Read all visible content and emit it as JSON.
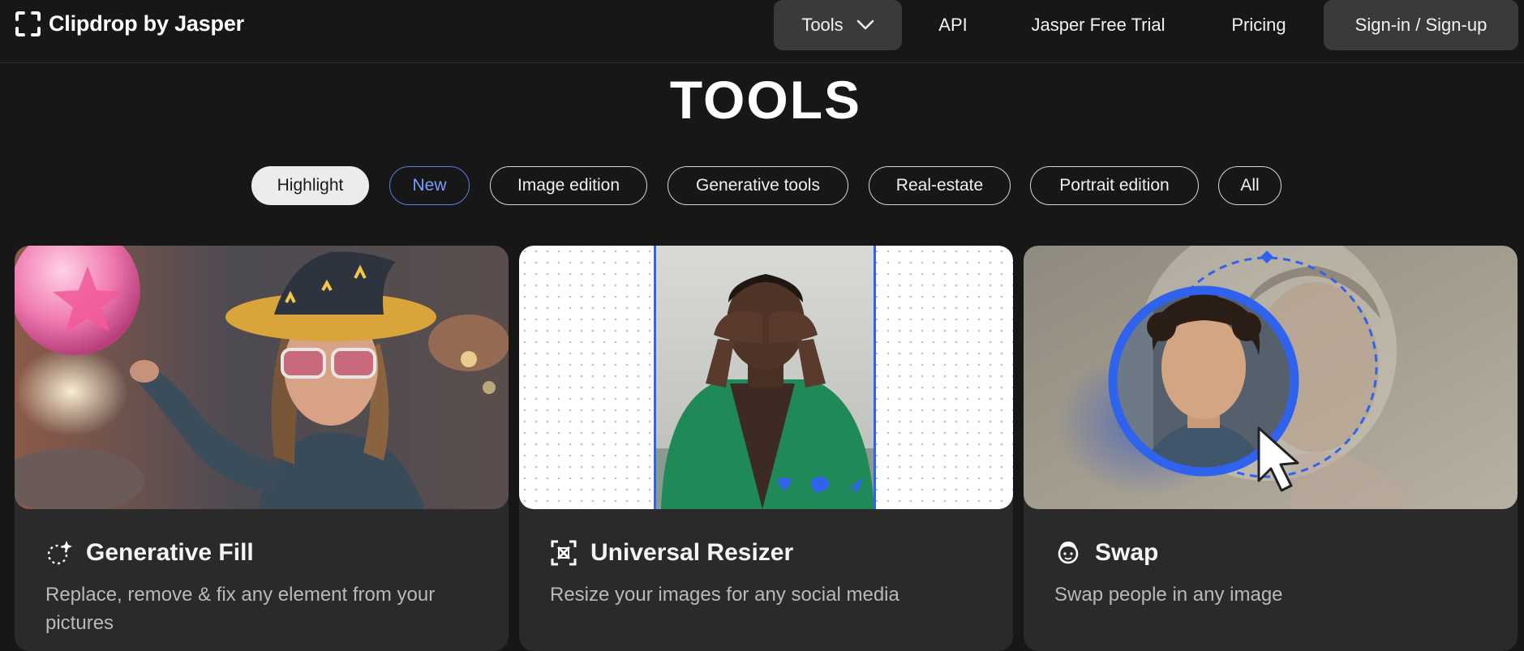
{
  "header": {
    "logo_text": "Clipdrop by Jasper",
    "nav": {
      "tools": "Tools",
      "api": "API",
      "trial": "Jasper Free Trial",
      "pricing": "Pricing",
      "sign": "Sign-in / Sign-up"
    }
  },
  "page_title": "TOOLS",
  "filters": [
    "Highlight",
    "New",
    "Image edition",
    "Generative tools",
    "Real-estate",
    "Portrait edition",
    "All"
  ],
  "selected_filter": "Highlight",
  "cards": [
    {
      "title": "Generative Fill",
      "description": "Replace, remove & fix any element from your pictures",
      "icon": "sparkle-dotted-circle-icon"
    },
    {
      "title": "Universal Resizer",
      "description": "Resize your images for any social media",
      "icon": "resize-frame-icon"
    },
    {
      "title": "Swap",
      "description": "Swap people in any image",
      "icon": "face-swap-icon"
    }
  ],
  "colors": {
    "background": "#171717",
    "card": "#2a2a2a",
    "accent_blue": "#2f63ee",
    "selected_chip": "#ececec"
  }
}
